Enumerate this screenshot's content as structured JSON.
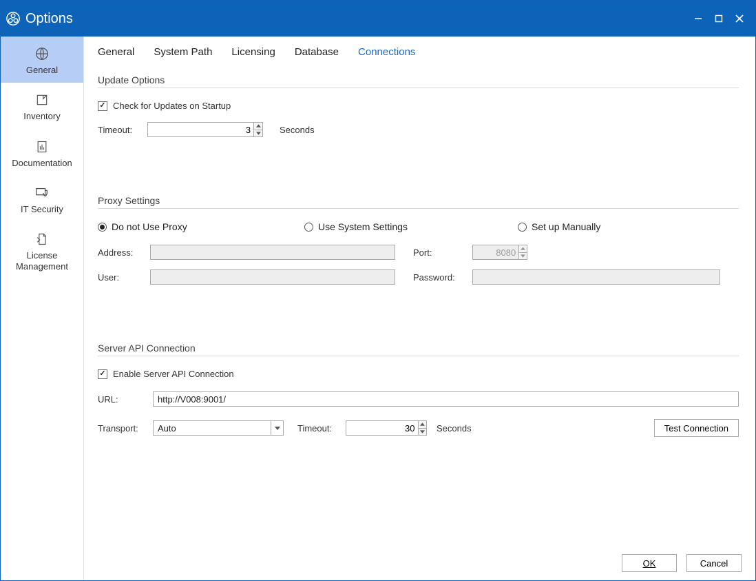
{
  "window": {
    "title": "Options"
  },
  "sidebar": {
    "items": [
      {
        "label": "General"
      },
      {
        "label": "Inventory"
      },
      {
        "label": "Documentation"
      },
      {
        "label": "IT Security"
      },
      {
        "label": "License Management"
      }
    ]
  },
  "tabs": {
    "items": [
      {
        "label": "General"
      },
      {
        "label": "System Path"
      },
      {
        "label": "Licensing"
      },
      {
        "label": "Database"
      },
      {
        "label": "Connections"
      }
    ],
    "active_index": 4
  },
  "update": {
    "section_title": "Update Options",
    "check_label": "Check for Updates on Startup",
    "checked": true,
    "timeout_label": "Timeout:",
    "timeout_value": "3",
    "timeout_unit": "Seconds"
  },
  "proxy": {
    "section_title": "Proxy Settings",
    "options": [
      {
        "label": "Do not Use Proxy"
      },
      {
        "label": "Use System Settings"
      },
      {
        "label": "Set up Manually"
      }
    ],
    "selected_index": 0,
    "address_label": "Address:",
    "address_value": "",
    "port_label": "Port:",
    "port_value": "8080",
    "user_label": "User:",
    "user_value": "",
    "password_label": "Password:",
    "password_value": ""
  },
  "server": {
    "section_title": "Server API Connection",
    "enable_label": "Enable Server API Connection",
    "enabled": true,
    "url_label": "URL:",
    "url_value": "http://V008:9001/",
    "transport_label": "Transport:",
    "transport_value": "Auto",
    "timeout_label": "Timeout:",
    "timeout_value": "30",
    "timeout_unit": "Seconds",
    "test_button": "Test Connection"
  },
  "footer": {
    "ok": "OK",
    "cancel": "Cancel"
  }
}
